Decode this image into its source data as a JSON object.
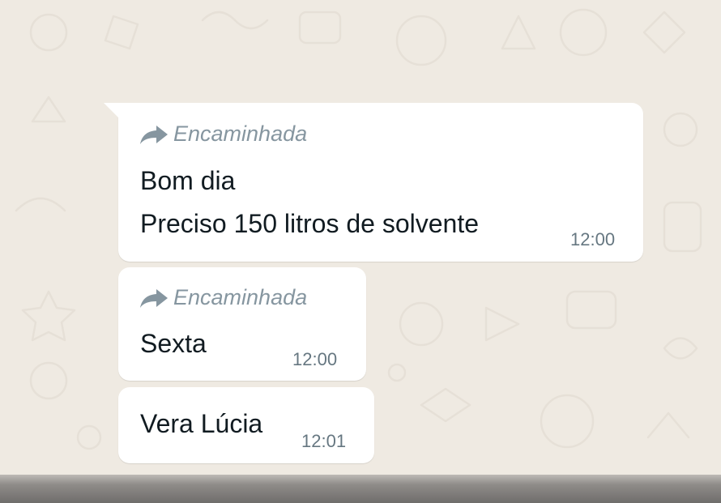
{
  "messages": [
    {
      "forwarded_label": "Encaminhada",
      "lines": [
        "Bom dia",
        "Preciso 150 litros de solvente"
      ],
      "time": "12:00"
    },
    {
      "forwarded_label": "Encaminhada",
      "lines": [
        "Sexta"
      ],
      "time": "12:00"
    },
    {
      "lines": [
        "Vera Lúcia"
      ],
      "time": "12:01"
    }
  ],
  "colors": {
    "wallpaper": "#efeae2",
    "bubble": "#ffffff",
    "text": "#111b21",
    "meta": "#8696a0",
    "timestamp": "#667781"
  },
  "icons": [
    "forward-arrow-icon"
  ]
}
